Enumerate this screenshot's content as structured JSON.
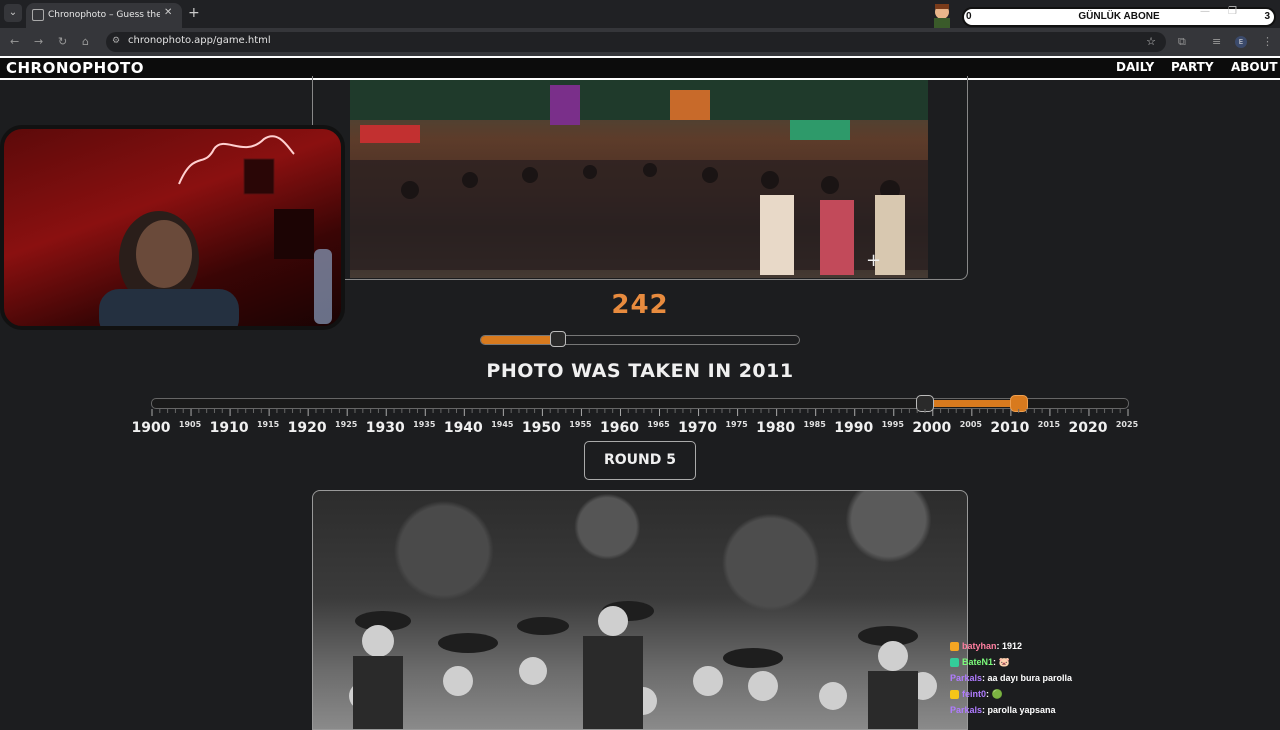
{
  "browser": {
    "tab_title": "Chronophoto – Guess the Year",
    "tab_close": "✕",
    "new_tab": "+",
    "url": "chronophoto.app/game.html",
    "overlay_bar": {
      "left": "0",
      "title": "GÜNLÜK ABONE",
      "right": "3"
    },
    "window_controls": [
      "—",
      "❐",
      "✕"
    ]
  },
  "site": {
    "logo": "CHRONOPHOTO",
    "nav": [
      "DAILY",
      "PARTY",
      "ABOUT"
    ]
  },
  "game": {
    "score": "242",
    "score_fraction": 0.242,
    "result_text": "PHOTO WAS TAKEN IN 2011",
    "guess_year": 1999,
    "actual_year": 2011,
    "year_min": 1900,
    "year_max": 2025,
    "round_label": "ROUND 5",
    "timeline_labels": [
      {
        "year": 1900,
        "label": "1900",
        "major": true
      },
      {
        "year": 1905,
        "label": "1905",
        "major": false
      },
      {
        "year": 1910,
        "label": "1910",
        "major": true
      },
      {
        "year": 1915,
        "label": "1915",
        "major": false
      },
      {
        "year": 1920,
        "label": "1920",
        "major": true
      },
      {
        "year": 1925,
        "label": "1925",
        "major": false
      },
      {
        "year": 1930,
        "label": "1930",
        "major": true
      },
      {
        "year": 1935,
        "label": "1935",
        "major": false
      },
      {
        "year": 1940,
        "label": "1940",
        "major": true
      },
      {
        "year": 1945,
        "label": "1945",
        "major": false
      },
      {
        "year": 1950,
        "label": "1950",
        "major": true
      },
      {
        "year": 1955,
        "label": "1955",
        "major": false
      },
      {
        "year": 1960,
        "label": "1960",
        "major": true
      },
      {
        "year": 1965,
        "label": "1965",
        "major": false
      },
      {
        "year": 1970,
        "label": "1970",
        "major": true
      },
      {
        "year": 1975,
        "label": "1975",
        "major": false
      },
      {
        "year": 1980,
        "label": "1980",
        "major": true
      },
      {
        "year": 1985,
        "label": "1985",
        "major": false
      },
      {
        "year": 1990,
        "label": "1990",
        "major": true
      },
      {
        "year": 1995,
        "label": "1995",
        "major": false
      },
      {
        "year": 2000,
        "label": "2000",
        "major": true
      },
      {
        "year": 2005,
        "label": "2005",
        "major": false
      },
      {
        "year": 2010,
        "label": "2010",
        "major": true
      },
      {
        "year": 2015,
        "label": "2015",
        "major": false
      },
      {
        "year": 2020,
        "label": "2020",
        "major": true
      },
      {
        "year": 2025,
        "label": "2025",
        "major": false
      }
    ]
  },
  "chat": [
    {
      "user": "batyhan",
      "message": "1912",
      "color": "#ff7fa0",
      "badge": "#f5a623"
    },
    {
      "user": "BateN1",
      "message": "🐷",
      "color": "#7cfc7c",
      "badge": "#33cc99"
    },
    {
      "user": "Parkals",
      "message": "aa dayı bura parolla",
      "color": "#b07cff",
      "badge": ""
    },
    {
      "user": "feint0",
      "message": "🟢",
      "color": "#b07cff",
      "badge": "#f5c518"
    },
    {
      "user": "Parkals",
      "message": "parolla yapsana",
      "color": "#b07cff",
      "badge": ""
    }
  ],
  "colors": {
    "accent": "#d87a1e",
    "score": "#e88b3e",
    "background": "#1c1d1f"
  }
}
